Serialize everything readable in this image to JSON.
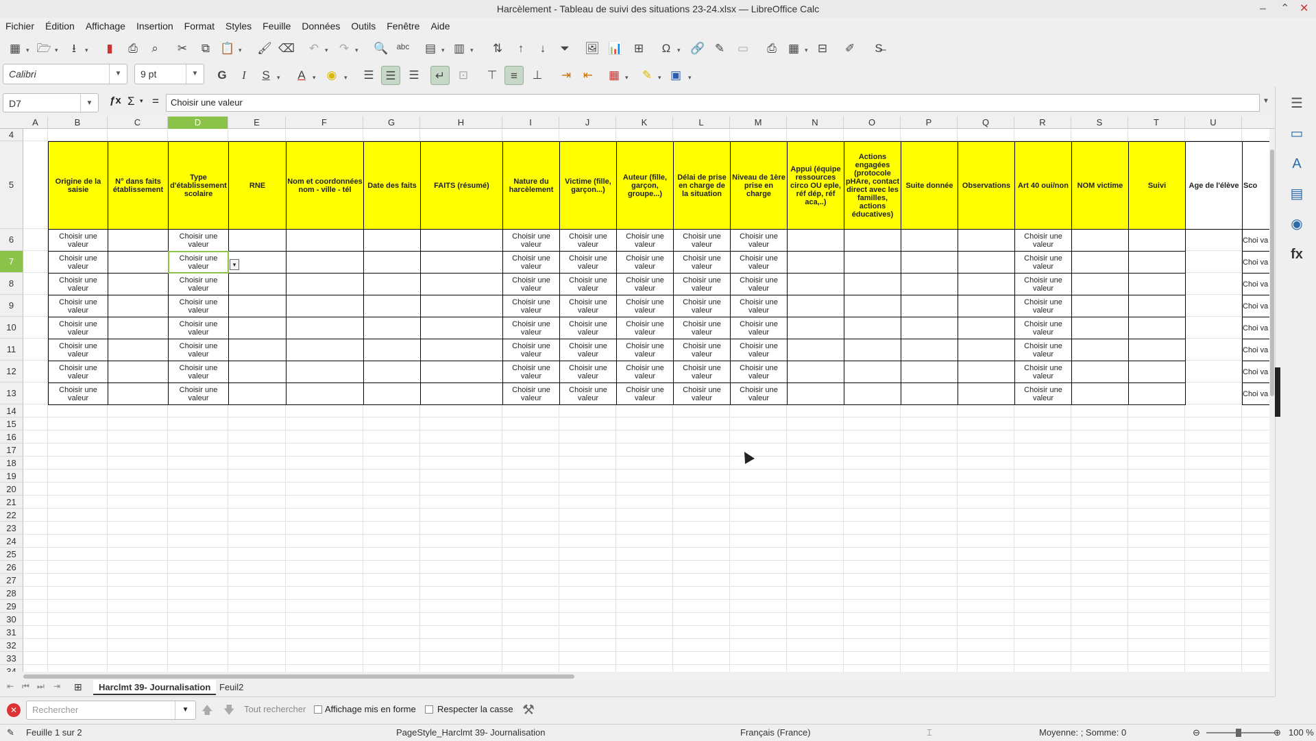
{
  "window": {
    "title": "Harcèlement - Tableau de suivi des situations 23-24.xlsx — LibreOffice Calc"
  },
  "menu": [
    "Fichier",
    "Édition",
    "Affichage",
    "Insertion",
    "Format",
    "Styles",
    "Feuille",
    "Données",
    "Outils",
    "Fenêtre",
    "Aide"
  ],
  "format_toolbar": {
    "font_name": "Calibri",
    "font_size": "9 pt"
  },
  "formula_bar": {
    "name_box": "D7",
    "content": "Choisir une  valeur"
  },
  "columns": [
    {
      "l": "A"
    },
    {
      "l": "B"
    },
    {
      "l": "C"
    },
    {
      "l": "D",
      "sel": true
    },
    {
      "l": "E"
    },
    {
      "l": "F"
    },
    {
      "l": "G"
    },
    {
      "l": "H"
    },
    {
      "l": "I"
    },
    {
      "l": "J"
    },
    {
      "l": "K"
    },
    {
      "l": "L"
    },
    {
      "l": "M"
    },
    {
      "l": "N"
    },
    {
      "l": "O"
    },
    {
      "l": "P"
    },
    {
      "l": "Q"
    },
    {
      "l": "R"
    },
    {
      "l": "S"
    },
    {
      "l": "T"
    },
    {
      "l": "U"
    }
  ],
  "rows": [
    "4",
    "5",
    "6",
    "7",
    "8",
    "9",
    "10",
    "11",
    "12",
    "13",
    "14",
    "15",
    "16",
    "17",
    "18",
    "19",
    "20",
    "21",
    "22",
    "23",
    "24",
    "25",
    "26",
    "27",
    "28",
    "29",
    "30",
    "31",
    "32",
    "33",
    "34"
  ],
  "selected_row": "7",
  "headers": {
    "B": "Origine de la saisie",
    "C": "N° dans faits établissement",
    "D": "Type d'établissement scolaire",
    "E": "RNE",
    "F": "Nom et coordonnées nom - ville - tél",
    "G": "Date des faits",
    "H": "FAITS (résumé)",
    "I": "Nature du harcèlement",
    "J": "Victime (fille, garçon...)",
    "K": "Auteur (fille, garçon, groupe...)",
    "L": "Délai de prise en charge de la situation",
    "M": "Niveau de 1ère prise en charge",
    "N": "Appui (équipe ressources circo OU eple, réf dép, réf aca,..)",
    "O": "Actions engagées (protocole pHAre, contact direct avec les familles, actions éducatives)",
    "P": "Suite donnée",
    "Q": "Observations",
    "R": "Art 40 oui/non",
    "S": "NOM victime",
    "T": "Suivi",
    "U": "Age de l'élève",
    "V": "Sco"
  },
  "cell_value": "Choisir une valeur",
  "cell_value_cut": "Choi va",
  "sheet_tabs": [
    "Harclmt 39- Journalisation",
    "Feuil2"
  ],
  "find_bar": {
    "placeholder": "Rechercher",
    "find_all": "Tout rechercher",
    "formatted": "Affichage mis en forme",
    "match_case": "Respecter la casse"
  },
  "status": {
    "sheet": "Feuille 1 sur 2",
    "page_style": "PageStyle_Harclmt 39- Journalisation",
    "language": "Français (France)",
    "summary": "Moyenne: ; Somme: 0",
    "zoom": "100 %"
  }
}
